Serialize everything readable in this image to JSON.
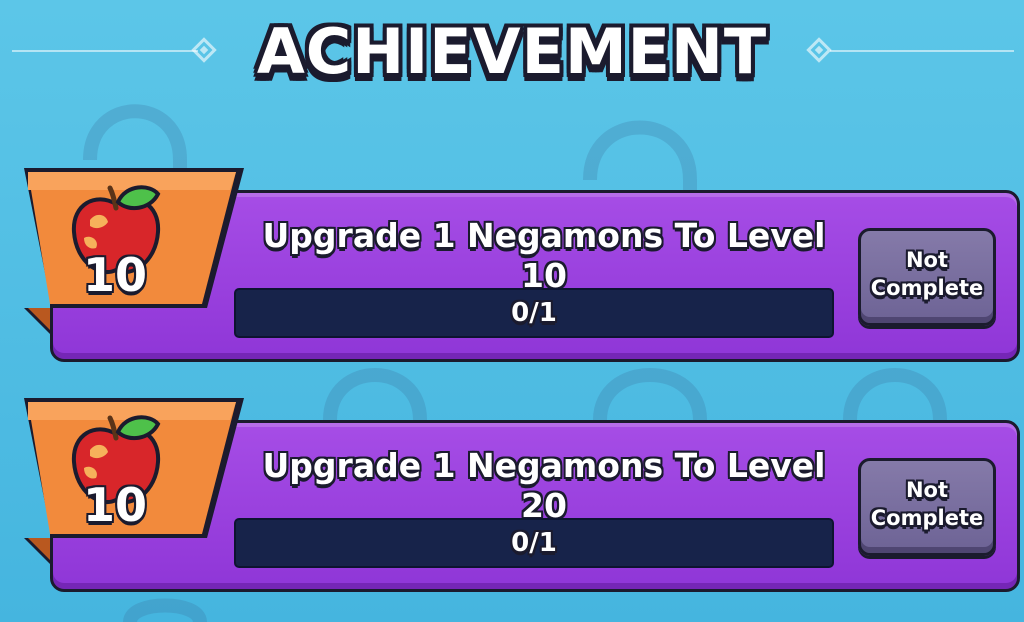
{
  "header": {
    "title": "ACHIEVEMENT"
  },
  "achievements": [
    {
      "reward": {
        "icon": "apple-icon",
        "amount": "10"
      },
      "title": "Upgrade 1 Negamons To Level 10",
      "progress": {
        "text": "0/1",
        "fraction": 0
      },
      "status_label": "Not\nComplete"
    },
    {
      "reward": {
        "icon": "apple-icon",
        "amount": "10"
      },
      "title": "Upgrade 1 Negamons To Level 20",
      "progress": {
        "text": "0/1",
        "fraction": 0
      },
      "status_label": "Not\nComplete"
    }
  ],
  "colors": {
    "background": "#4fbde4",
    "card": "#9a42dd",
    "ribbon": "#f28a3c",
    "progress_track": "#17234a",
    "button": "#7a6fa0"
  }
}
